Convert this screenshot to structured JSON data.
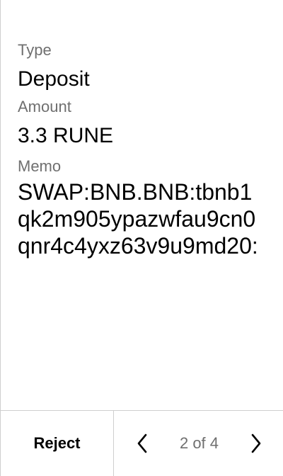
{
  "fields": {
    "type_label": "Type",
    "type_value": "Deposit",
    "amount_label": "Amount",
    "amount_value": "3.3 RUNE",
    "memo_label": "Memo",
    "memo_value": "SWAP:BNB.BNB:tbnb1qk2m905ypazwfau9cn0qnr4c4yxz63v9u9md20:"
  },
  "footer": {
    "reject_label": "Reject",
    "page_indicator": "2 of 4",
    "prev_icon": "chevron-left-icon",
    "next_icon": "chevron-right-icon"
  },
  "colors": {
    "text": "#000000",
    "muted": "#6f6f6f",
    "divider": "#cfcfcf",
    "background": "#ffffff"
  }
}
